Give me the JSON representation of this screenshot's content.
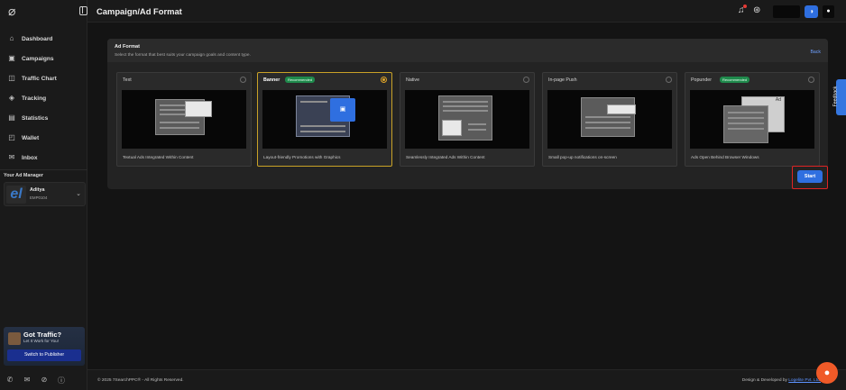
{
  "header": {
    "title": "Campaign/Ad Format"
  },
  "sidebar": {
    "items": [
      {
        "label": "Dashboard",
        "icon": "home-icon"
      },
      {
        "label": "Campaigns",
        "icon": "campaign-icon"
      },
      {
        "label": "Traffic Chart",
        "icon": "chart-icon"
      },
      {
        "label": "Tracking",
        "icon": "tracking-icon"
      },
      {
        "label": "Statistics",
        "icon": "statistics-icon"
      },
      {
        "label": "Wallet",
        "icon": "wallet-icon"
      },
      {
        "label": "Inbox",
        "icon": "inbox-icon"
      }
    ],
    "ad_manager": {
      "title": "Your Ad Manager",
      "name": "Aditya",
      "id": "EMP0104"
    },
    "promo": {
      "title": "Got Traffic?",
      "subtitle": "Let It Work for You!",
      "button": "Switch to Publisher"
    }
  },
  "panel": {
    "title": "Ad Format",
    "subtitle": "Select the format that best suits your campaign goals and content type.",
    "back": "Back",
    "start": "Start",
    "formats": [
      {
        "name": "Text",
        "badge": "",
        "selected": false,
        "description": "Textual Ads Integrated Within Content"
      },
      {
        "name": "Banner",
        "badge": "Recommended",
        "selected": true,
        "description": "Layout-friendly Promotions with Graphics"
      },
      {
        "name": "Native",
        "badge": "",
        "selected": false,
        "description": "Seamlessly Integrated Ads Within Content"
      },
      {
        "name": "In-page Push",
        "badge": "",
        "selected": false,
        "description": "Small pop-up notifications on-screen"
      },
      {
        "name": "Popunder",
        "badge": "Recommended",
        "selected": false,
        "description": "Ads Open Behind Browser Windows",
        "preview_label": "Ad"
      }
    ]
  },
  "feedback": "Feedback",
  "footer": {
    "copyright": "© 2025 7SearchPPC® - All Rights Reserved.",
    "credit_prefix": "Design & Developed by",
    "credit_link": "Logelite Pvt. Ltd."
  },
  "colors": {
    "accent": "#2f6fe0",
    "selected_border": "#c9a227",
    "recommended": "#1f8a4c",
    "highlight": "#e02424"
  }
}
